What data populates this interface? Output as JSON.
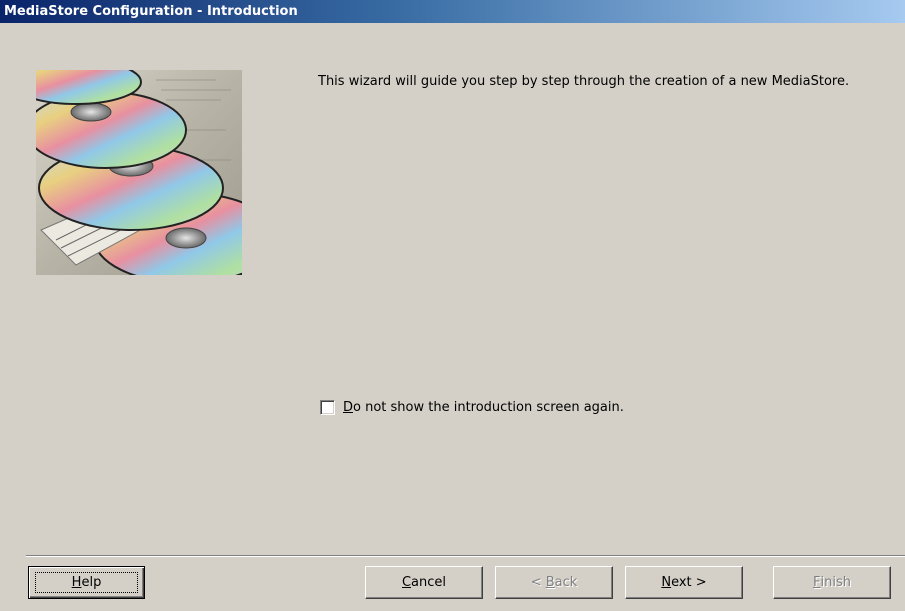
{
  "window": {
    "title": "MediaStore Configuration - Introduction"
  },
  "main": {
    "intro_text": "This wizard will guide you step by step through the creation of a new MediaStore.",
    "checkbox": {
      "mnemonic": "D",
      "label_rest": "o not show the introduction screen again.",
      "checked": false
    }
  },
  "buttons": {
    "help": {
      "mnemonic": "H",
      "rest": "elp"
    },
    "cancel": {
      "mnemonic": "C",
      "rest": "ancel"
    },
    "back": {
      "prefix": "< ",
      "mnemonic": "B",
      "rest": "ack",
      "enabled": false
    },
    "next": {
      "mnemonic": "N",
      "rest": "ext >"
    },
    "finish": {
      "mnemonic": "F",
      "rest": "inish",
      "enabled": false
    }
  },
  "icons": {
    "artwork": "cd-discs-image"
  }
}
